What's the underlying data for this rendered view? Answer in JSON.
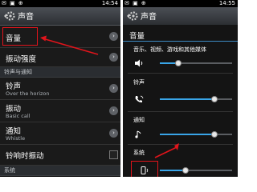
{
  "left_screen": {
    "status": {
      "icons": "✉ ▣ ⊕",
      "time": "14:54",
      "battery": "▮"
    },
    "title": "声音",
    "rows": [
      {
        "label": "音量"
      },
      {
        "label": "振动强度"
      }
    ],
    "section_ringtone": "铃声与通知",
    "ring_rows": [
      {
        "label": "铃声",
        "sub": "Over the horizon"
      },
      {
        "label": "振动",
        "sub": "Basic call"
      },
      {
        "label": "通知",
        "sub": "Whistle"
      }
    ],
    "vibrate_when_ringing": "铃响时振动",
    "section_system": "系统"
  },
  "right_screen": {
    "status": {
      "icons": "✉ ▣ ⊕",
      "time": "14:55",
      "battery": "▮"
    },
    "title": "声音",
    "panel_title": "音量",
    "media": {
      "label": "音乐、视频、游戏和其他媒体",
      "level": 0.25
    },
    "ringtone": {
      "label": "铃声",
      "level": 0.75
    },
    "notification": {
      "label": "通知",
      "level": 0.75
    },
    "system": {
      "label": "系统",
      "level": 0.35
    }
  },
  "colors": {
    "accent": "#39a5e8",
    "highlight": "#e1141b"
  }
}
